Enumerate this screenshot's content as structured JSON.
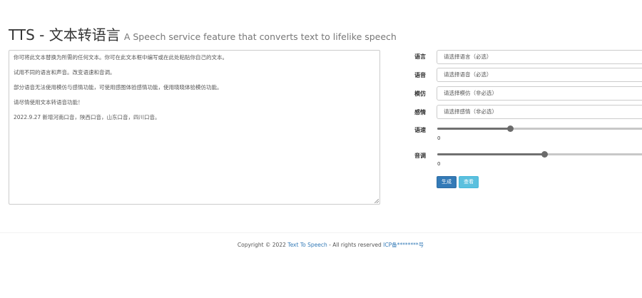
{
  "header": {
    "title": "TTS - 文本转语言",
    "subtitle": "A Speech service feature that converts text to lifelike speech"
  },
  "editor": {
    "lines": [
      "你可将此文本替换为所需的任何文本。你可在此文本框中编写或在此处粘贴你自己的文本。",
      "试用不同的语言和声音。改变语速和音调。",
      "部分语音无法使用模仿与感情功能，可使用感图体验感情功能，使用晓晓体验模仿功能。",
      "请尽情使用文本转语音功能！",
      "2022.9.27 新增河南口音，陕西口音，山东口音，四川口音。"
    ]
  },
  "form": {
    "language": {
      "label": "语言",
      "placeholder": "请选择语言（必选）"
    },
    "voice": {
      "label": "语音",
      "placeholder": "请选择语音（必选）"
    },
    "imitate": {
      "label": "模仿",
      "placeholder": "请选择模仿（非必选）"
    },
    "emotion": {
      "label": "感情",
      "placeholder": "请选择感情（非必选）"
    },
    "rate": {
      "label": "语速",
      "value_text": "0",
      "fill_fraction": 0.34
    },
    "pitch": {
      "label": "音调",
      "value_text": "0",
      "fill_fraction": 0.5
    }
  },
  "buttons": {
    "generate": "生成",
    "view": "查看"
  },
  "footer": {
    "prefix": "Copyright © 2022 ",
    "site_link": "Text To Speech",
    "middle": " - All rights reserved ",
    "icp_link": "ICP备********号"
  },
  "colors": {
    "primary": "#337ab7",
    "info": "#5bc0de",
    "link": "#337ab7"
  }
}
